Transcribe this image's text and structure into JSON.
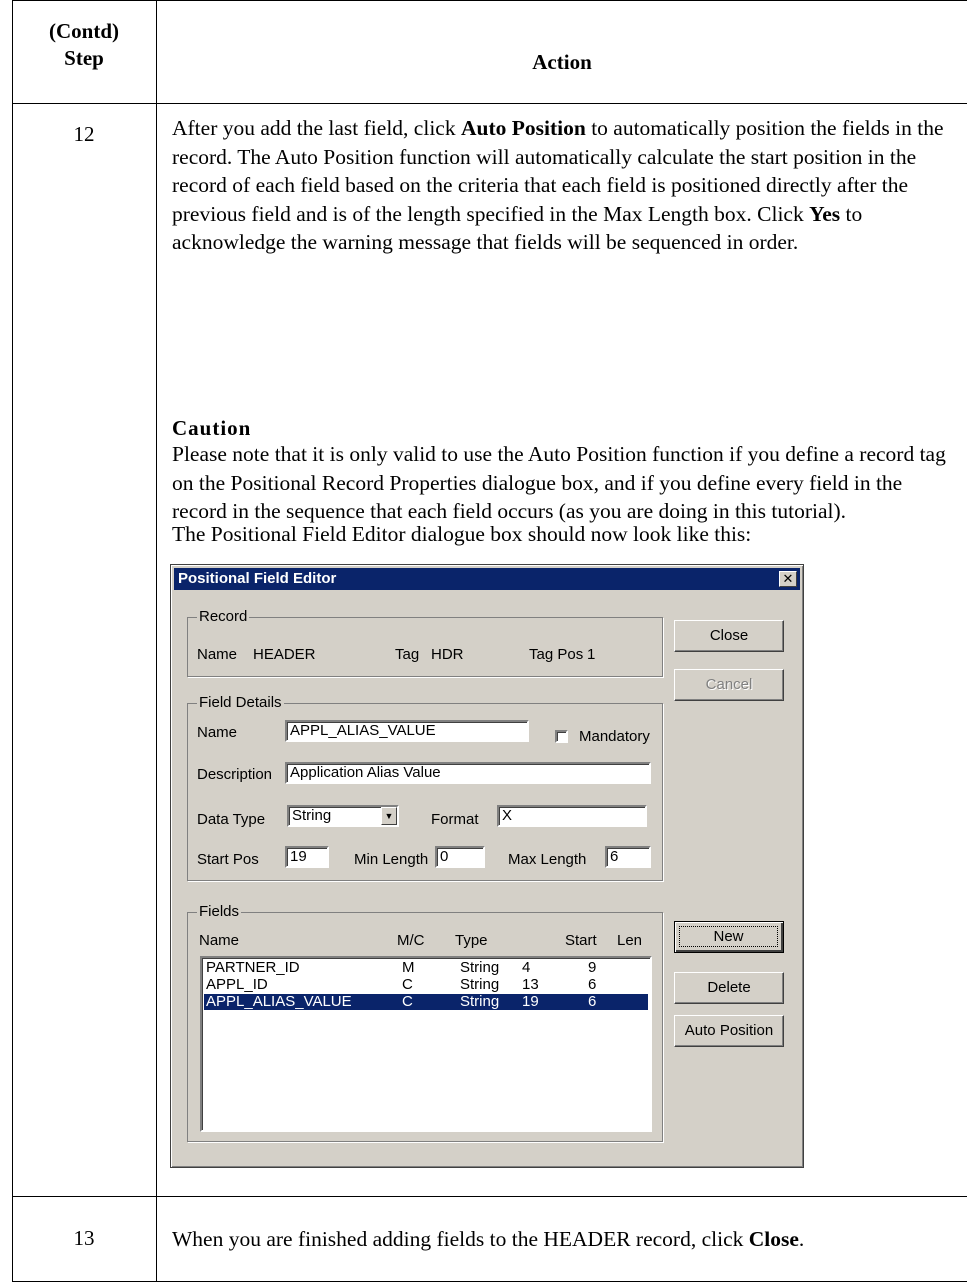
{
  "table": {
    "header_step": "(Contd)\nStep",
    "header_action": "Action"
  },
  "step12": {
    "number": "12",
    "para1": [
      {
        "t": "After you add the last field, click "
      },
      {
        "t": "Auto Position",
        "b": true
      },
      {
        "t": " to automatically position the fields in the record. The Auto Position function will automatically calculate the start position in the record of each field based on the criteria that each field is positioned directly after the previous field and is of the length specified in the Max Length box. Click "
      },
      {
        "t": "Yes",
        "b": true
      },
      {
        "t": " to acknowledge the warning message that fields will be sequenced in order."
      }
    ],
    "caution_title": "Caution",
    "caution_text": "Please note that it is only valid to use the Auto Position function if you define a record tag on the Positional Record Properties dialogue box, and if you define every field in the record in the sequence that each field occurs (as you are doing in this tutorial).",
    "lead_in": "The Positional Field Editor dialogue box should now look like this:"
  },
  "dialog": {
    "title": "Positional Field Editor",
    "close_glyph": "✕",
    "record": {
      "group_label": "Record",
      "name_label": "Name",
      "name_value": "HEADER",
      "tag_label": "Tag",
      "tag_value": "HDR",
      "tagpos_label": "Tag Pos",
      "tagpos_value": "1"
    },
    "field_details": {
      "group_label": "Field Details",
      "name_label": "Name",
      "name_value": "APPL_ALIAS_VALUE",
      "mandatory_label": "Mandatory",
      "mandatory_checked": false,
      "description_label": "Description",
      "description_value": "Application Alias Value",
      "datatype_label": "Data Type",
      "datatype_value": "String",
      "format_label": "Format",
      "format_value": "X",
      "startpos_label": "Start Pos",
      "startpos_value": "19",
      "minlength_label": "Min Length",
      "minlength_value": "0",
      "maxlength_label": "Max Length",
      "maxlength_value": "6"
    },
    "fields": {
      "group_label": "Fields",
      "columns": {
        "name": "Name",
        "mc": "M/C",
        "type": "Type",
        "start": "Start",
        "len": "Len"
      },
      "rows": [
        {
          "name": "PARTNER_ID",
          "mc": "M",
          "type": "String",
          "start": "4",
          "len": "9",
          "selected": false
        },
        {
          "name": "APPL_ID",
          "mc": "C",
          "type": "String",
          "start": "13",
          "len": "6",
          "selected": false
        },
        {
          "name": "APPL_ALIAS_VALUE",
          "mc": "C",
          "type": "String",
          "start": "19",
          "len": "6",
          "selected": true
        }
      ]
    },
    "buttons": {
      "close": "Close",
      "cancel": "Cancel",
      "new": "New",
      "delete": "Delete",
      "auto_position": "Auto Position"
    }
  },
  "step13": {
    "number": "13",
    "text": [
      {
        "t": "When you are finished adding fields to the HEADER record, click "
      },
      {
        "t": "Close",
        "b": true
      },
      {
        "t": "."
      }
    ]
  }
}
